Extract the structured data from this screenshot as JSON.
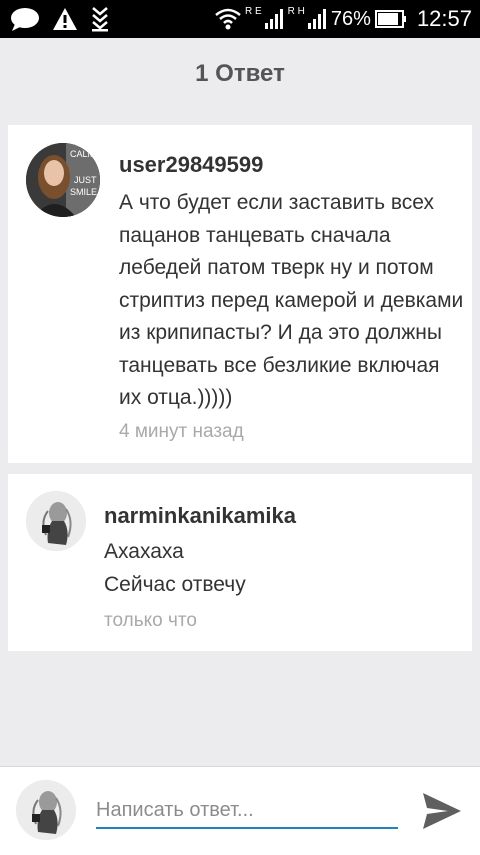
{
  "status_bar": {
    "signal1_letters": "R E",
    "signal2_letters": "R H",
    "battery": "76%",
    "time": "12:57"
  },
  "header": {
    "title": "1 Ответ"
  },
  "comments": [
    {
      "username": "user29849599",
      "text": "А что будет если заставить всех пацанов танцевать сначала лебедей патом тверк ну и потом стриптиз перед камерой и девками из крипипасты? И да это должны танцевать все безликие включая их отца.)))))",
      "time": "4 минут назад",
      "avatar_text": [
        "CALM",
        "JUST",
        "SMILE"
      ]
    },
    {
      "username": "narminkanikamika",
      "text_lines": [
        "Ахахаха",
        "Сейчас отвечу"
      ],
      "time": "только что"
    }
  ],
  "composer": {
    "placeholder": "Написать ответ...",
    "accent": "#1e86b8"
  }
}
